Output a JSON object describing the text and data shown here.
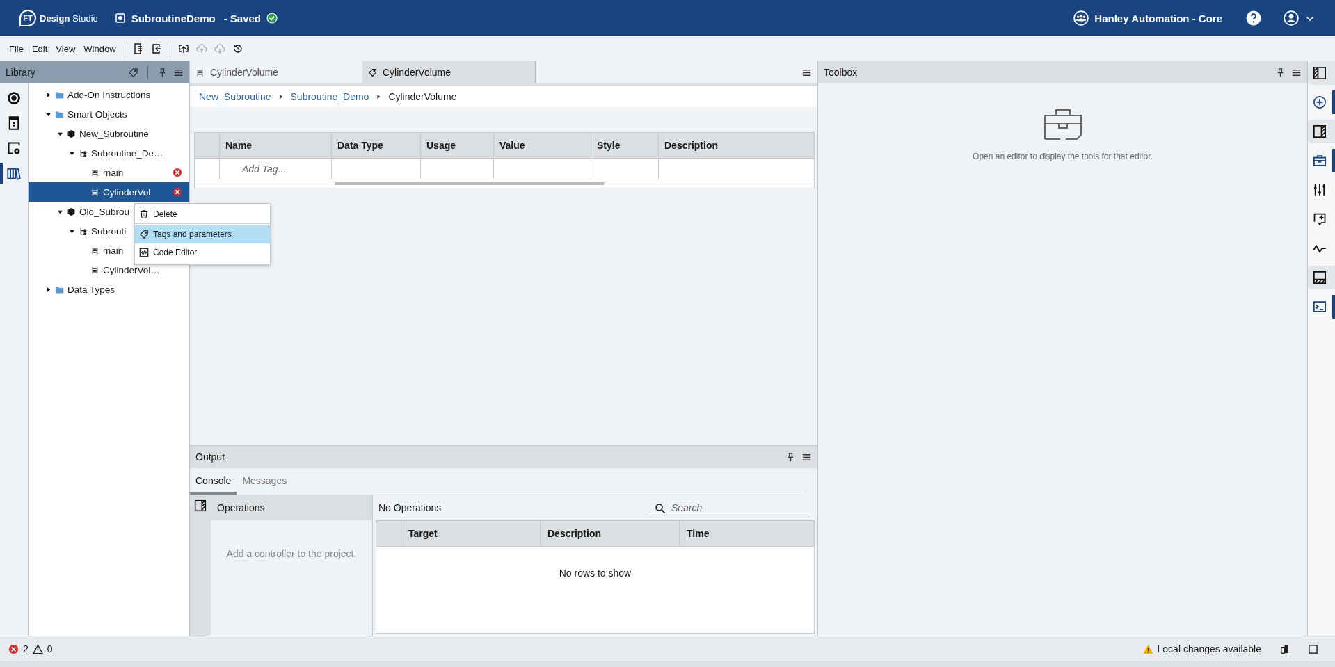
{
  "header": {
    "logo_letters": "FT",
    "app_name": "**Design** Studio",
    "project": "SubroutineDemo",
    "status": "- Saved",
    "org": "Hanley Automation - Core"
  },
  "menu": [
    "File",
    "Edit",
    "View",
    "Window"
  ],
  "toolbar": [
    {
      "disabled": false
    },
    {
      "disabled": false
    },
    {
      "disabled": false
    },
    {
      "disabled": true
    },
    {
      "disabled": true
    },
    {
      "disabled": false
    }
  ],
  "library": {
    "title": "Library",
    "rail": [
      {
        "selected": false
      },
      {
        "selected": false
      },
      {
        "selected": false
      },
      {
        "selected": true
      }
    ],
    "tree": [
      {
        "label": "Add-On Instructions",
        "kind": "folder",
        "expanded": false,
        "selected": false,
        "error": false
      },
      {
        "label": "Smart Objects",
        "kind": "folder",
        "expanded": true,
        "selected": false,
        "error": false,
        "children": [
          {
            "label": "New_Subroutine",
            "kind": "object",
            "expanded": true,
            "selected": false,
            "error": false,
            "children": [
              {
                "label": "Subroutine_De…",
                "kind": "program",
                "expanded": true,
                "selected": false,
                "error": false,
                "children": [
                  {
                    "label": "main",
                    "kind": "routine",
                    "selected": false,
                    "error": true
                  },
                  {
                    "label": "CylinderVol",
                    "kind": "routine",
                    "selected": true,
                    "error": true
                  }
                ]
              }
            ]
          },
          {
            "label": "Old_Subrou",
            "kind": "object",
            "expanded": true,
            "selected": false,
            "error": false,
            "children": [
              {
                "label": "Subrouti",
                "kind": "program",
                "expanded": true,
                "selected": false,
                "error": false,
                "children": [
                  {
                    "label": "main",
                    "kind": "routine",
                    "selected": false,
                    "error": false
                  },
                  {
                    "label": "CylinderVol…",
                    "kind": "routine",
                    "selected": false,
                    "error": false
                  }
                ]
              }
            ]
          }
        ]
      },
      {
        "label": "Data Types",
        "kind": "folder",
        "expanded": false,
        "selected": false,
        "error": false
      }
    ]
  },
  "context_menu": [
    {
      "label": "Delete",
      "selected": false
    },
    {
      "label": "Tags and parameters",
      "selected": true
    },
    {
      "label": "Code Editor",
      "selected": false
    }
  ],
  "editor_tabs": [
    {
      "label": "CylinderVolume",
      "kind": "routine",
      "selected": false
    },
    {
      "label": "CylinderVolume",
      "kind": "tags",
      "selected": true
    }
  ],
  "breadcrumb": [
    {
      "label": "New_Subroutine",
      "current": false
    },
    {
      "label": "Subroutine_Demo",
      "current": false
    },
    {
      "label": "CylinderVolume",
      "current": true
    }
  ],
  "tag_table": {
    "columns": [
      "Name",
      "Data Type",
      "Usage",
      "Value",
      "Style",
      "Description"
    ],
    "add_placeholder": "Add Tag..."
  },
  "output": {
    "title": "Output",
    "tabs": [
      {
        "label": "Console",
        "selected": true
      },
      {
        "label": "Messages",
        "selected": false
      }
    ],
    "operations_title": "Operations",
    "operations_hint": "Add a controller to the project.",
    "status": "No Operations",
    "search_placeholder": "Search",
    "columns": [
      "Target",
      "Description",
      "Time"
    ],
    "empty": "No rows to show"
  },
  "toolbox": {
    "title": "Toolbox",
    "message": "Open an editor to display the tools for that editor."
  },
  "right_rail": [
    {
      "selected": false
    },
    {
      "selected": true
    },
    {
      "selected": false
    },
    {
      "selected": true
    },
    {
      "selected": false
    },
    {
      "selected": false
    },
    {
      "selected": false
    },
    {
      "selected": false
    },
    {
      "selected": true
    }
  ],
  "status_bar": {
    "errors": "2",
    "warnings": "0",
    "notice": "Local changes available"
  }
}
